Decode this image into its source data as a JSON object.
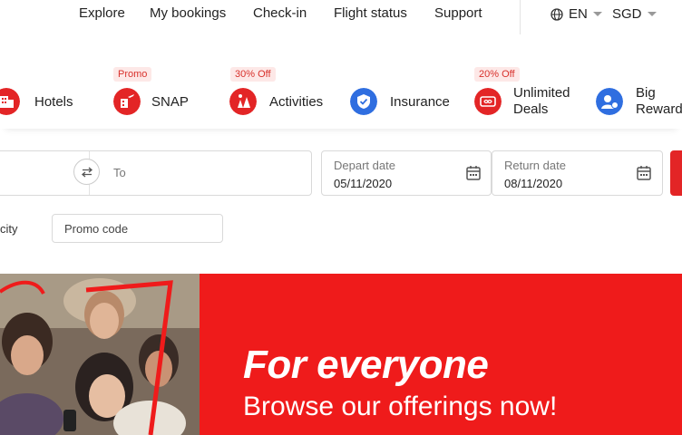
{
  "nav": {
    "items": [
      "Explore",
      "My bookings",
      "Check-in",
      "Flight status",
      "Support"
    ],
    "language": "EN",
    "currency": "SGD"
  },
  "products": [
    {
      "label": "Hotels",
      "badge": "",
      "icon": "hotel-icon"
    },
    {
      "label": "SNAP",
      "badge": "Promo",
      "icon": "snap-icon"
    },
    {
      "label": "Activities",
      "badge": "30% Off",
      "icon": "activities-icon"
    },
    {
      "label": "Insurance",
      "badge": "",
      "icon": "shield-icon"
    },
    {
      "label": "Unlimited Deals",
      "label_line1": "Unlimited",
      "label_line2": "Deals",
      "badge": "20% Off",
      "icon": "ticket-icon"
    },
    {
      "label": "Big Rewards",
      "label_line1": "Big",
      "label_line2": "Rewards",
      "badge": "",
      "icon": "rewards-icon"
    }
  ],
  "search": {
    "to_placeholder": "To",
    "depart_label": "Depart date",
    "depart_value": "05/11/2020",
    "return_label": "Return date",
    "return_value": "08/11/2020",
    "city_fragment": "city",
    "promo_placeholder": "Promo code"
  },
  "banner": {
    "headline": "For everyone",
    "subline": "Browse our offerings now!"
  },
  "colors": {
    "brand_red": "#e32526",
    "insurance_blue": "#2f6ee0",
    "badge_bg": "#fde8e7"
  }
}
